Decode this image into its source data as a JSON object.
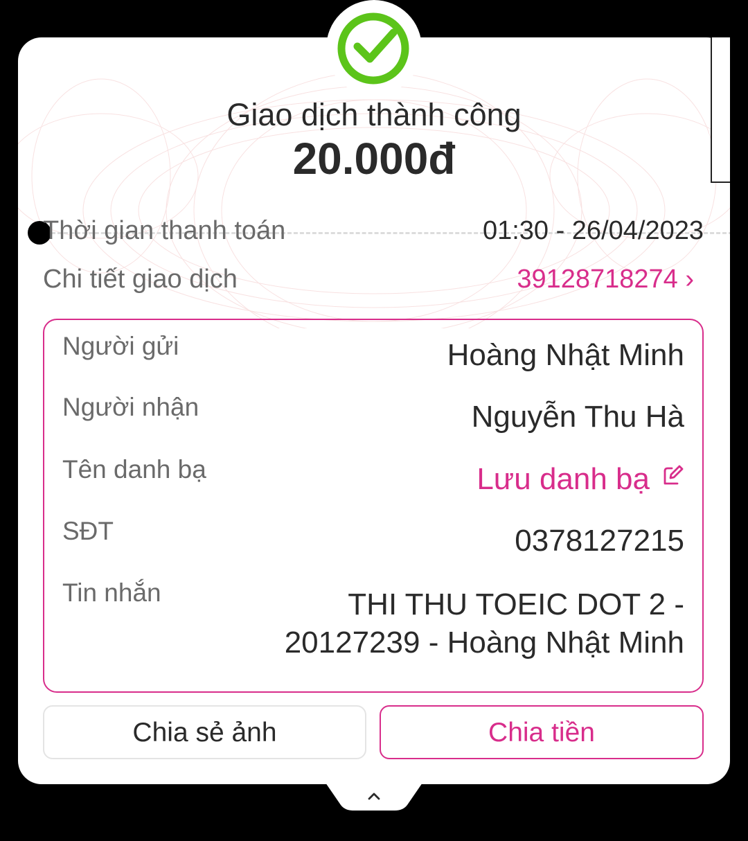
{
  "header": {
    "title": "Giao dịch thành công",
    "amount": "20.000đ"
  },
  "summary": {
    "time_label": "Thời gian thanh toán",
    "time_value": "01:30 - 26/04/2023",
    "detail_label": "Chi tiết giao dịch",
    "detail_value": "39128718274 ›"
  },
  "details": {
    "sender_label": "Người gửi",
    "sender_value": "Hoàng Nhật Minh",
    "receiver_label": "Người nhận",
    "receiver_value": "Nguyễn Thu Hà",
    "contact_label": "Tên danh bạ",
    "contact_value": "Lưu danh bạ",
    "phone_label": "SĐT",
    "phone_value": "0378127215",
    "message_label": "Tin nhắn",
    "message_line1": "THI THU TOEIC DOT 2 -",
    "message_line2": "20127239 - Hoàng Nhật Minh"
  },
  "actions": {
    "share_label": "Chia sẻ ảnh",
    "split_label": "Chia tiền"
  },
  "colors": {
    "accent": "#d82d8b",
    "success": "#5cc41a",
    "text": "#2a2a2a",
    "muted": "#6a6a6a"
  },
  "icons": [
    "check-circle-icon",
    "edit-icon",
    "chevron-up-icon"
  ]
}
